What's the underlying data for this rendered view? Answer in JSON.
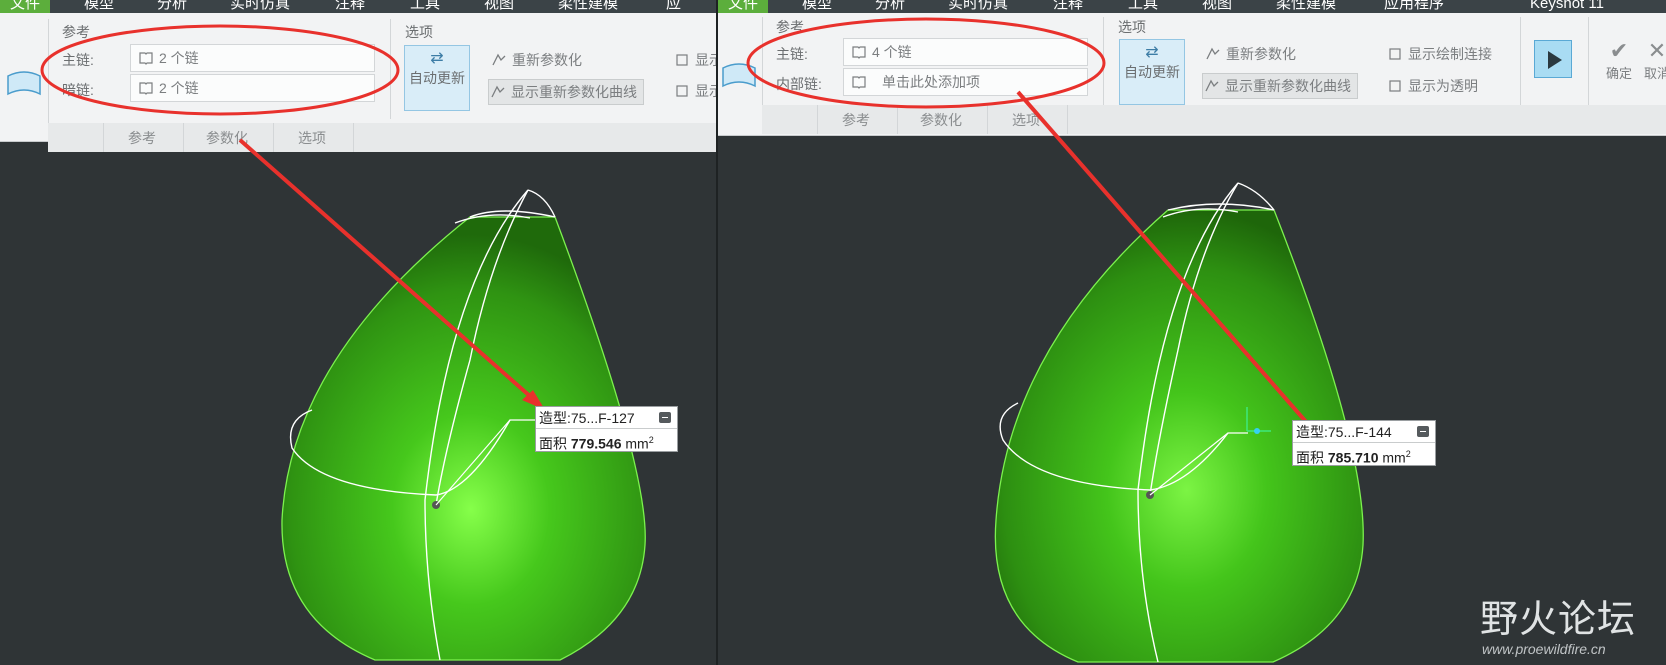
{
  "left": {
    "menu": [
      "文件",
      "模型",
      "分析",
      "实时仿真",
      "注释",
      "工具",
      "视图",
      "柔性建模",
      "应"
    ],
    "ribbon": {
      "refs_title": "参考",
      "main_chain_label": "主链:",
      "main_chain_value": "2 个链",
      "second_chain_label": "暗链:",
      "second_chain_value": "2 个链",
      "options_title": "选项",
      "auto_update": "自动更新",
      "reparam": "重新参数化",
      "show_reparam_curves": "显示重新参数化曲线",
      "show_cut_1": "显示",
      "show_cut_2": "显示",
      "tabs": [
        "参考",
        "参数化",
        "选项"
      ]
    },
    "annotation": {
      "title": "造型:75...F-127",
      "area_label": "面积",
      "area_value": "779.546",
      "unit": "mm",
      "unit_exp": "2"
    }
  },
  "right": {
    "menu": [
      "文件",
      "模型",
      "分析",
      "实时仿真",
      "注释",
      "工具",
      "视图",
      "柔性建模",
      "应用程序",
      "Keyshot 11"
    ],
    "ribbon": {
      "refs_title": "参考",
      "main_chain_label": "主链:",
      "main_chain_value": "4 个链",
      "inner_chain_label": "内部链:",
      "inner_chain_placeholder": "单击此处添加项",
      "options_title": "选项",
      "auto_update": "自动更新",
      "reparam": "重新参数化",
      "show_reparam_curves": "显示重新参数化曲线",
      "show_sketch_links": "显示绘制连接",
      "show_transparent": "显示为透明",
      "confirm": "确定",
      "cancel": "取消",
      "tabs": [
        "参考",
        "参数化",
        "选项"
      ]
    },
    "annotation": {
      "title": "造型:75...F-144",
      "area_label": "面积",
      "area_value": "785.710",
      "unit": "mm",
      "unit_exp": "2"
    }
  },
  "watermark": {
    "logo": "野火论坛",
    "url": "www.proewildfire.cn"
  },
  "colors": {
    "surface": "#46c81c",
    "highlight": "red-ellipse #e8312c",
    "background": "#2f3436"
  }
}
